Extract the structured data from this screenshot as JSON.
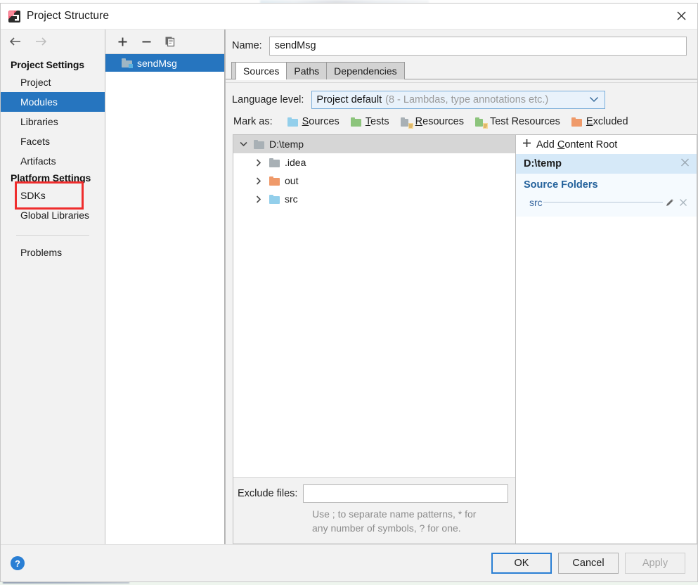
{
  "window": {
    "title": "Project Structure",
    "logo_icon": "intellij-idea-logo",
    "close_icon": "close-icon"
  },
  "sidebar": {
    "back_icon": "arrow-left-icon",
    "forward_icon": "arrow-right-icon",
    "groups": [
      {
        "title": "Project Settings",
        "items": [
          {
            "label": "Project",
            "selected": false
          },
          {
            "label": "Modules",
            "selected": true
          },
          {
            "label": "Libraries",
            "selected": false
          },
          {
            "label": "Facets",
            "selected": false
          },
          {
            "label": "Artifacts",
            "selected": false,
            "annotated": true
          }
        ]
      },
      {
        "title": "Platform Settings",
        "items": [
          {
            "label": "SDKs",
            "selected": false
          },
          {
            "label": "Global Libraries",
            "selected": false
          }
        ]
      }
    ],
    "extra_items": [
      {
        "label": "Problems",
        "selected": false
      }
    ],
    "annotation_color": "#ef2d2d"
  },
  "modules_panel": {
    "toolbar": {
      "add_label": "+",
      "add_icon": "plus-icon",
      "remove_label": "−",
      "remove_icon": "minus-icon",
      "copy_icon": "copy-icon"
    },
    "items": [
      {
        "label": "sendMsg",
        "icon": "module-folder-icon",
        "selected": true
      }
    ],
    "selection_color": "#2675bf"
  },
  "form": {
    "name_label": "Name:",
    "name_value": "sendMsg",
    "name_placeholder": ""
  },
  "tabs": [
    {
      "label": "Sources",
      "active": true
    },
    {
      "label": "Paths",
      "active": false
    },
    {
      "label": "Dependencies",
      "active": false
    }
  ],
  "sources_tab": {
    "language_level": {
      "label": "Language level:",
      "value": "Project default",
      "hint": "(8 - Lambdas, type annotations etc.)",
      "chevron_icon": "chevron-down-icon"
    },
    "mark_as": {
      "label": "Mark as:",
      "options": [
        {
          "label": "Sources",
          "mnemonic": "S",
          "color": "#93cfeb",
          "icon": "folder-sources-icon"
        },
        {
          "label": "Tests",
          "mnemonic": "T",
          "color": "#8cc47c",
          "icon": "folder-tests-icon"
        },
        {
          "label": "Resources",
          "mnemonic": "R",
          "color": "#a8b0b5",
          "icon": "folder-resources-icon"
        },
        {
          "label": "Test Resources",
          "mnemonic": "",
          "color": "#8cc47c",
          "icon": "folder-test-resources-icon"
        },
        {
          "label": "Excluded",
          "mnemonic": "E",
          "color": "#ef9a6a",
          "icon": "folder-excluded-icon"
        }
      ]
    },
    "tree": [
      {
        "label": "D:\\temp",
        "depth": 0,
        "expanded": true,
        "selected": true,
        "color": "#a8b0b5",
        "icon": "folder-icon",
        "twisty": "chevron-down-icon"
      },
      {
        "label": ".idea",
        "depth": 1,
        "expanded": false,
        "selected": false,
        "color": "#a8b0b5",
        "icon": "folder-icon",
        "twisty": "chevron-right-icon"
      },
      {
        "label": "out",
        "depth": 1,
        "expanded": false,
        "selected": false,
        "color": "#ef9a6a",
        "icon": "folder-excluded-icon",
        "twisty": "chevron-right-icon"
      },
      {
        "label": "src",
        "depth": 1,
        "expanded": false,
        "selected": false,
        "color": "#93cfeb",
        "icon": "folder-sources-icon",
        "twisty": "chevron-right-icon"
      }
    ],
    "exclude": {
      "label": "Exclude files:",
      "value": "",
      "hint_line1": "Use ; to separate name patterns, * for",
      "hint_line2": "any number of symbols, ? for one."
    },
    "content_roots": {
      "add_label": "Add Content Root",
      "add_mnemonic": "C",
      "add_icon": "plus-icon",
      "root_path": "D:\\temp",
      "root_remove_icon": "close-icon",
      "source_folders_title": "Source Folders",
      "folders": [
        {
          "name": "src",
          "edit_icon": "pencil-icon",
          "remove_icon": "close-icon"
        }
      ]
    }
  },
  "footer": {
    "help_icon": "help-icon",
    "help_label": "?",
    "buttons": [
      {
        "label": "OK",
        "state": "default"
      },
      {
        "label": "Cancel",
        "state": "normal"
      },
      {
        "label": "Apply",
        "state": "disabled"
      }
    ]
  }
}
